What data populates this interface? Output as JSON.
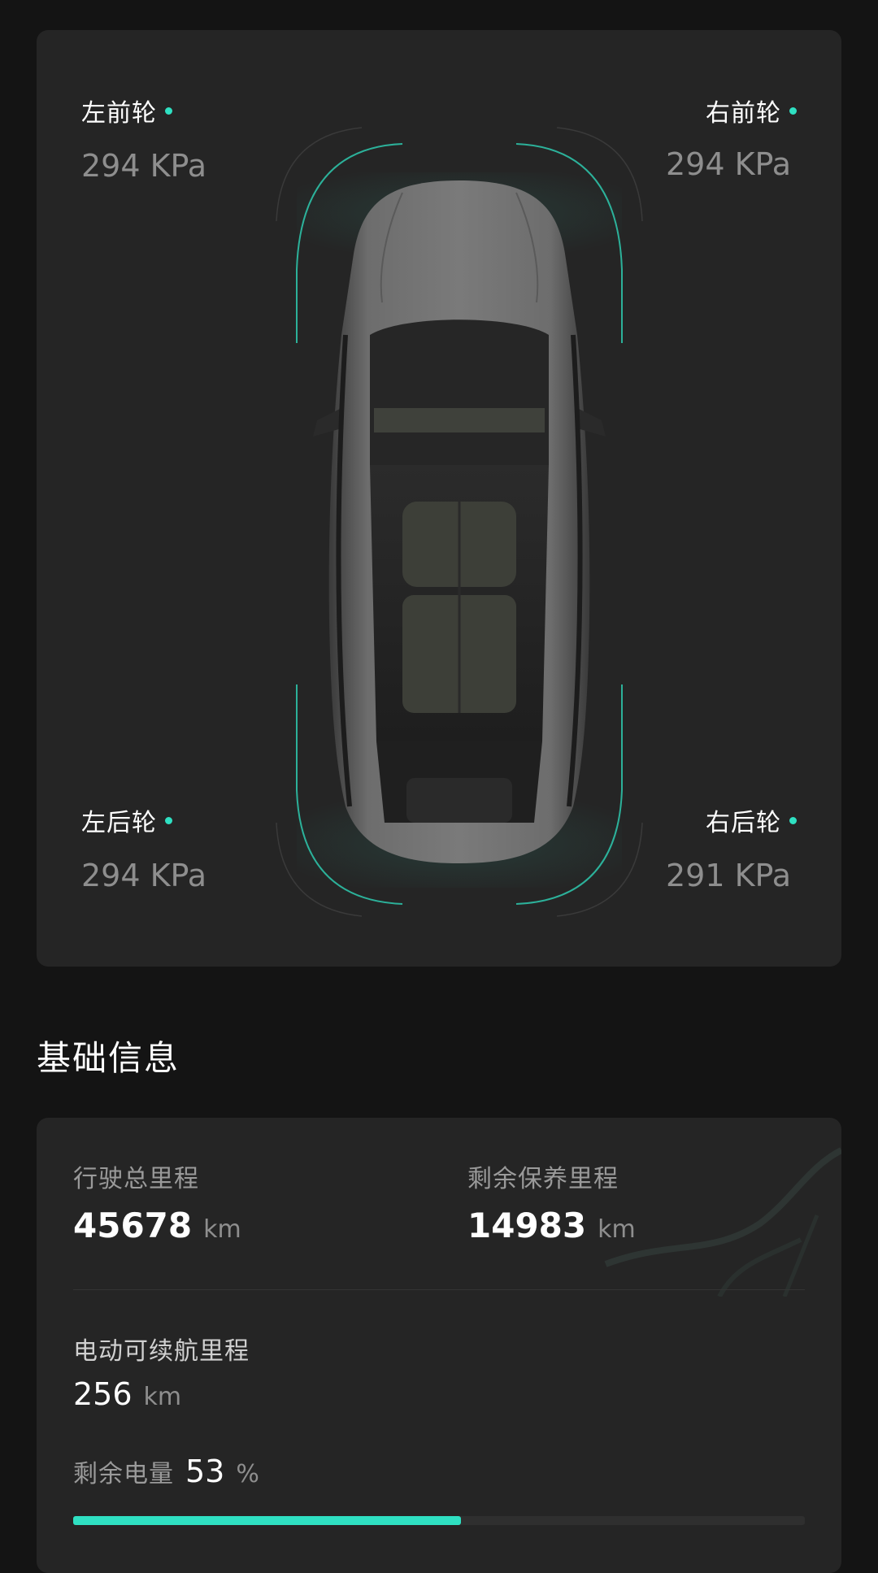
{
  "tires": {
    "front_left": {
      "label": "左前轮",
      "value": "294 KPa"
    },
    "front_right": {
      "label": "右前轮",
      "value": "294 KPa"
    },
    "rear_left": {
      "label": "左后轮",
      "value": "294 KPa"
    },
    "rear_right": {
      "label": "右后轮",
      "value": "291 KPa"
    }
  },
  "basic_info": {
    "title": "基础信息",
    "total_mileage": {
      "label": "行驶总里程",
      "value": "45678",
      "unit": "km"
    },
    "maintenance_mileage": {
      "label": "剩余保养里程",
      "value": "14983",
      "unit": "km"
    },
    "electric_range": {
      "label": "电动可续航里程",
      "value": "256",
      "unit": "km"
    },
    "battery": {
      "label": "剩余电量",
      "value": "53",
      "unit": "%",
      "percent": 53
    }
  },
  "colors": {
    "accent": "#2fe0c2",
    "card": "#252525",
    "background": "#141414"
  }
}
